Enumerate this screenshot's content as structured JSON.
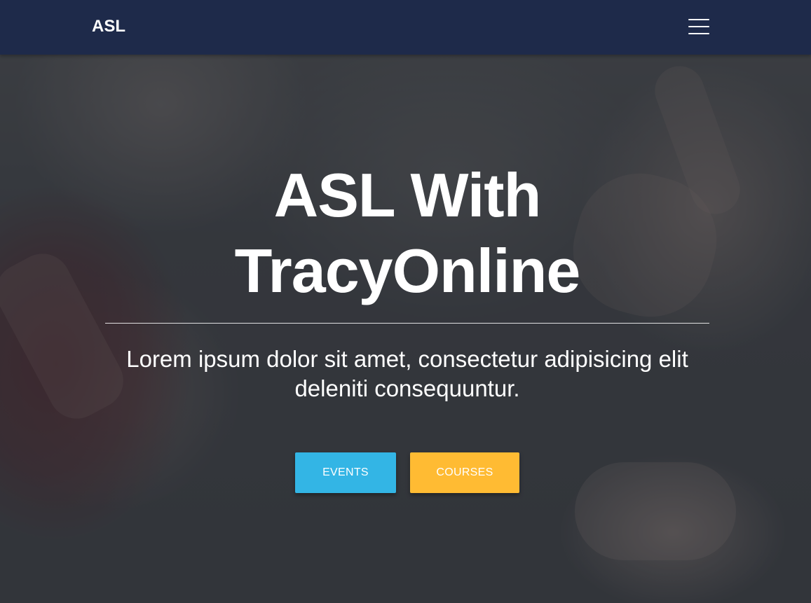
{
  "navbar": {
    "brand": "ASL",
    "menu_icon": "hamburger-menu-icon",
    "background_color": "#1e2a4a"
  },
  "hero": {
    "title": "ASL With TracyOnline",
    "subtitle": "Lorem ipsum dolor sit amet, consectetur adipisicing elit deleniti consequuntur.",
    "buttons": [
      {
        "label": "EVENTS",
        "color": "#33b5e5"
      },
      {
        "label": "COURSES",
        "color": "#ffbb33"
      }
    ]
  }
}
